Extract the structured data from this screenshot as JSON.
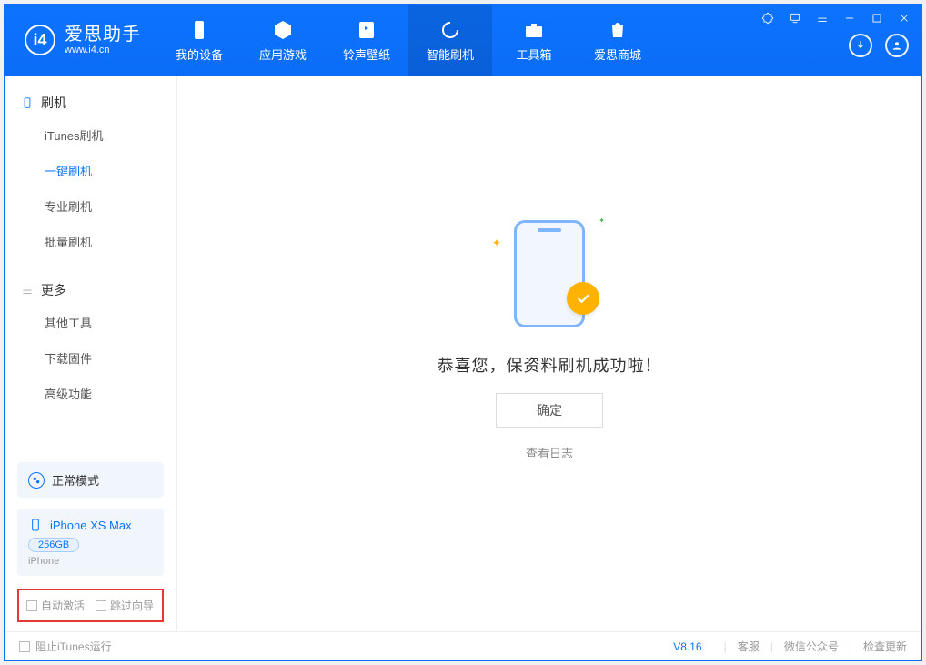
{
  "brand": {
    "name": "爱思助手",
    "url": "www.i4.cn"
  },
  "nav": {
    "my_device": "我的设备",
    "apps_games": "应用游戏",
    "ring_wall": "铃声壁纸",
    "smart_flash": "智能刷机",
    "toolbox": "工具箱",
    "store": "爱思商城"
  },
  "sidebar": {
    "section_flash": "刷机",
    "items_flash": {
      "itunes": "iTunes刷机",
      "one_click": "一键刷机",
      "pro": "专业刷机",
      "batch": "批量刷机"
    },
    "section_more": "更多",
    "items_more": {
      "other_tools": "其他工具",
      "download_fw": "下载固件",
      "advanced": "高级功能"
    },
    "mode_label": "正常模式",
    "device": {
      "name": "iPhone XS Max",
      "storage": "256GB",
      "type": "iPhone"
    },
    "chk_auto_activate": "自动激活",
    "chk_skip_guide": "跳过向导"
  },
  "main": {
    "success_msg": "恭喜您，保资料刷机成功啦！",
    "ok_btn": "确定",
    "log_link": "查看日志"
  },
  "footer": {
    "block_itunes": "阻止iTunes运行",
    "version": "V8.16",
    "support": "客服",
    "wechat": "微信公众号",
    "check_update": "检查更新"
  }
}
